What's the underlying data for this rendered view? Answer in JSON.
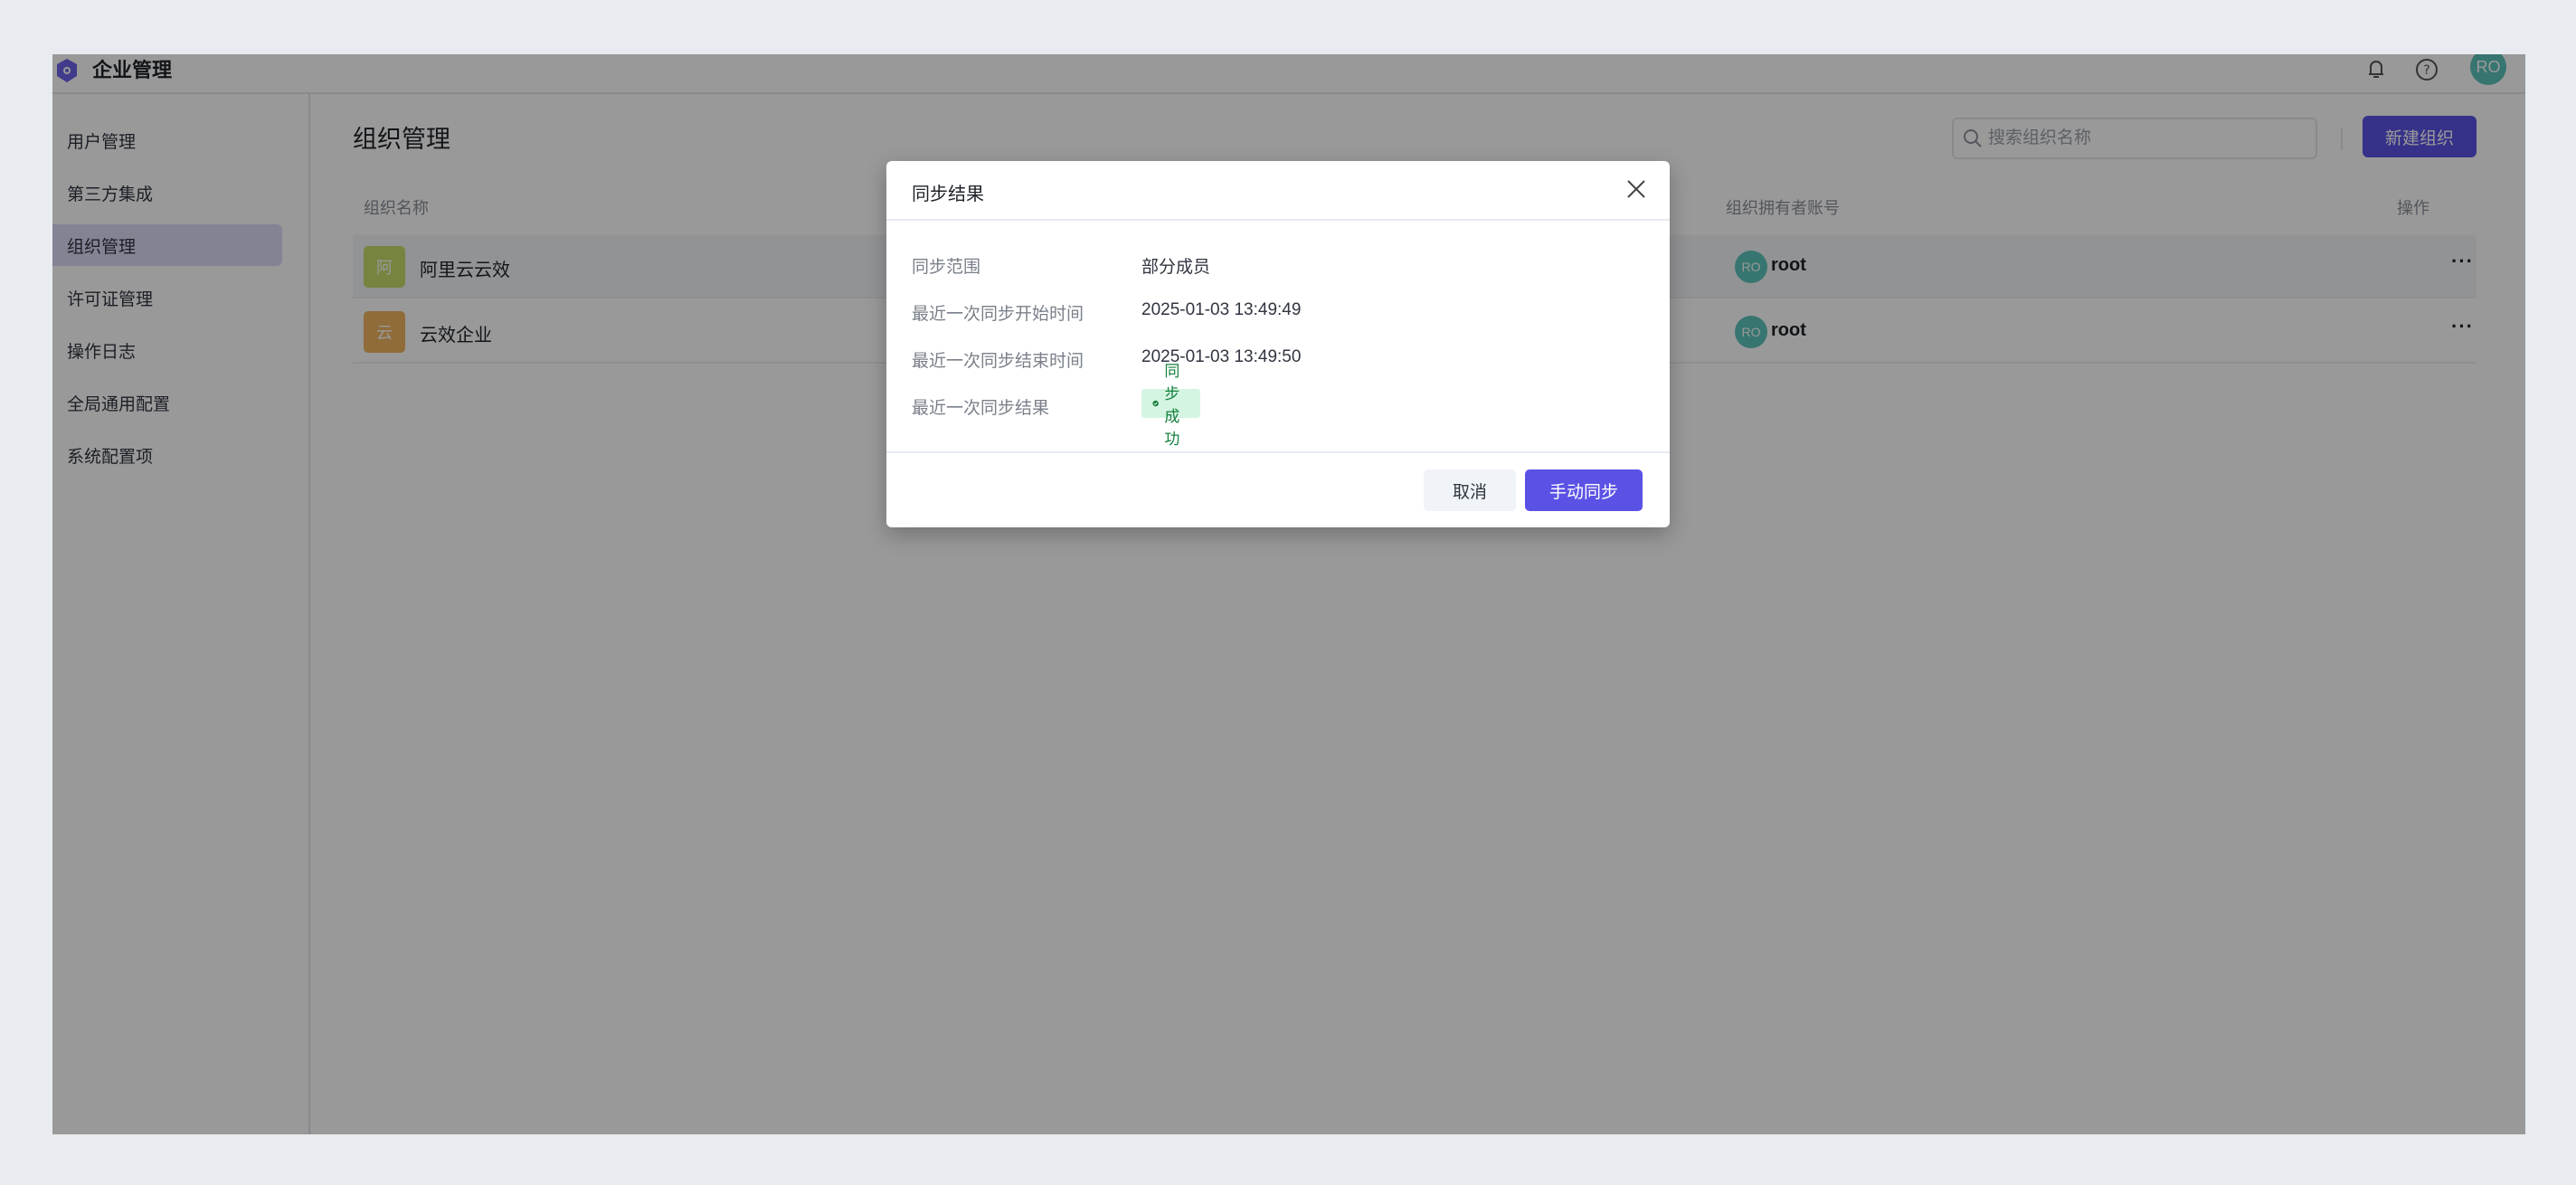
{
  "header": {
    "app_title": "企业管理",
    "user_avatar": "RO",
    "icons": [
      "bell-icon",
      "help-icon"
    ]
  },
  "sidebar": {
    "items": [
      {
        "label": "用户管理",
        "active": false
      },
      {
        "label": "第三方集成",
        "active": false
      },
      {
        "label": "组织管理",
        "active": true
      },
      {
        "label": "许可证管理",
        "active": false
      },
      {
        "label": "操作日志",
        "active": false
      },
      {
        "label": "全局通用配置",
        "active": false
      },
      {
        "label": "系统配置项",
        "active": false
      }
    ]
  },
  "main": {
    "title": "组织管理",
    "search": {
      "placeholder": "搜索组织名称",
      "value": ""
    },
    "new_button": "新建组织",
    "table": {
      "columns": [
        "组织名称",
        "组织拥有者账号",
        "操作"
      ],
      "rows": [
        {
          "badge": "阿",
          "badge_color": "#c4dc6a",
          "name": "阿里云云效",
          "owner_avatar": "RO",
          "owner": "root",
          "action": "···"
        },
        {
          "badge": "云",
          "badge_color": "#f0b461",
          "name": "云效企业",
          "owner_avatar": "RO",
          "owner": "root",
          "action": "···"
        }
      ]
    }
  },
  "dialog": {
    "title": "同步结果",
    "fields": [
      {
        "label": "同步范围",
        "value": "部分成员"
      },
      {
        "label": "最近一次同步开始时间",
        "value": "2025-01-03 13:49:49"
      },
      {
        "label": "最近一次同步结束时间",
        "value": "2025-01-03 13:49:50"
      },
      {
        "label": "最近一次同步结果",
        "value": "同步成功"
      }
    ],
    "cancel_label": "取消",
    "confirm_label": "手动同步"
  },
  "colors": {
    "accent": "#5b52e5",
    "success_bg": "#d5f5e3",
    "success_fg": "#15803d",
    "avatar": "#5cc4bb"
  }
}
